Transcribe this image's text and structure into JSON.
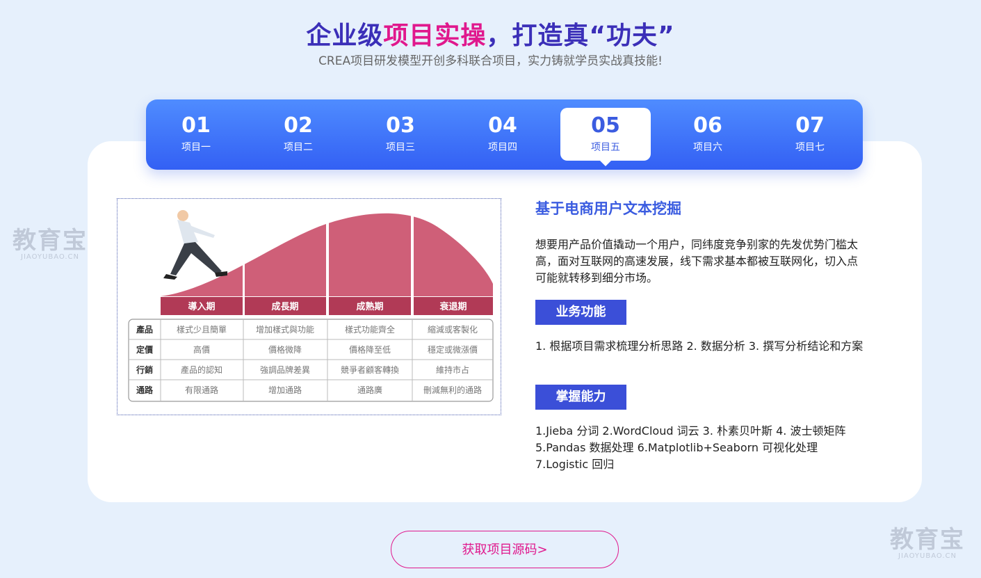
{
  "header": {
    "title_part1": "企业级",
    "title_highlight": "项目实操",
    "title_part2": "，打造真“功夫”",
    "subtitle": "CREA项目研发模型开创多科联合项目，实力铸就学员实战真技能!"
  },
  "tabs": [
    {
      "num": "01",
      "label": "项目一",
      "active": false
    },
    {
      "num": "02",
      "label": "项目二",
      "active": false
    },
    {
      "num": "03",
      "label": "项目三",
      "active": false
    },
    {
      "num": "04",
      "label": "项目四",
      "active": false
    },
    {
      "num": "05",
      "label": "项目五",
      "active": true
    },
    {
      "num": "06",
      "label": "项目六",
      "active": false
    },
    {
      "num": "07",
      "label": "项目七",
      "active": false
    }
  ],
  "figure": {
    "stages": [
      "導入期",
      "成長期",
      "成熟期",
      "衰退期"
    ],
    "rows": [
      {
        "head": "產品",
        "cells": [
          "樣式少且簡單",
          "增加樣式與功能",
          "樣式功能齊全",
          "縮減或客製化"
        ]
      },
      {
        "head": "定價",
        "cells": [
          "高價",
          "價格微降",
          "價格降至低",
          "穩定或微漲價"
        ]
      },
      {
        "head": "行銷",
        "cells": [
          "產品的認知",
          "強調品牌差異",
          "競爭者顧客轉換",
          "維持市占"
        ]
      },
      {
        "head": "通路",
        "cells": [
          "有限通路",
          "增加通路",
          "通路廣",
          "刪減無利的通路"
        ]
      }
    ]
  },
  "project": {
    "title": "基于电商用户文本挖掘",
    "description": "想要用产品价值撬动一个用户，同纬度竞争别家的先发优势门槛太高，面对互联网的高速发展，线下需求基本都被互联网化，切入点可能就转移到细分市场。",
    "tag1": "业务功能",
    "text1": "1. 根据项目需求梳理分析思路 2. 数据分析 3. 撰写分析结论和方案",
    "tag2": "掌握能力",
    "text2": "1.Jieba 分词 2.WordCloud 词云 3. 朴素贝叶斯 4. 波士顿矩阵 5.Pandas 数据处理 6.Matplotlib+Seaborn 可视化处理 7.Logistic 回归"
  },
  "cta": {
    "label": "获取项目源码>"
  },
  "watermark": {
    "big": "教育宝",
    "small": "JIAOYUBAO.CN"
  },
  "colors": {
    "primary": "#3b5ce0",
    "accent": "#e0188d",
    "curve": "#cf5f78",
    "stage_bar": "#b13a56"
  }
}
